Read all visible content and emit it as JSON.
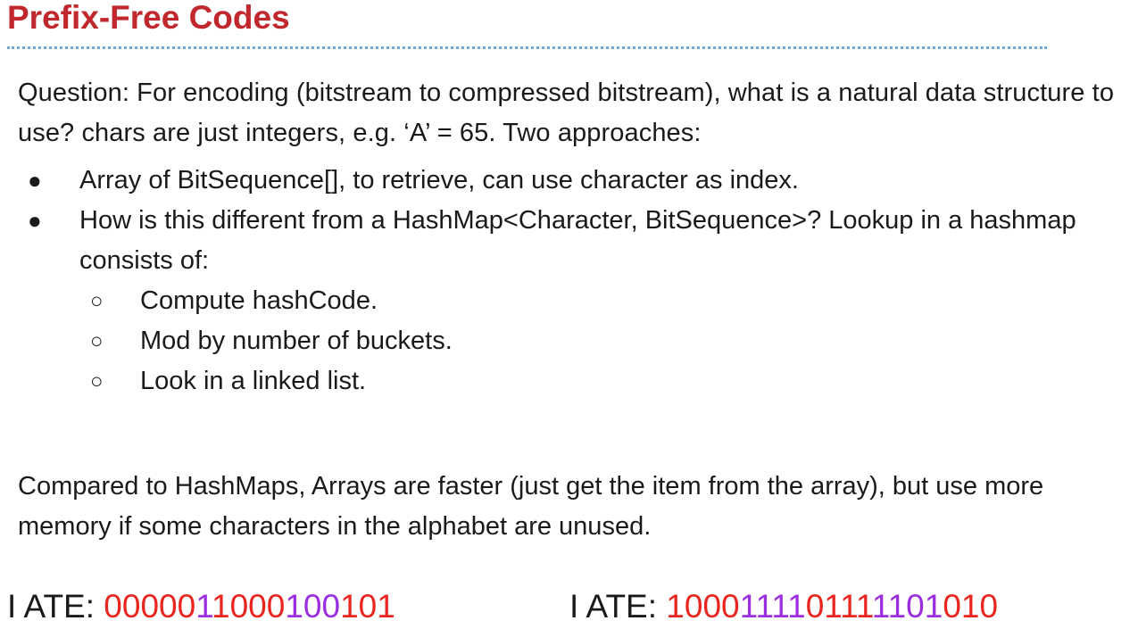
{
  "title": "Prefix-Free Codes",
  "question": "Question: For encoding (bitstream to compressed bitstream), what is a natural data structure to use?  chars are just integers, e.g. ‘A’ = 65. Two approaches:",
  "bullets": [
    {
      "marker": "●",
      "text": "Array of BitSequence[], to retrieve, can use character as index."
    },
    {
      "marker": "●",
      "text": "How is this different from a HashMap<Character, BitSequence>? Lookup in a hashmap consists of:",
      "sub_items": [
        {
          "marker": "○",
          "text": "Compute hashCode."
        },
        {
          "marker": "○",
          "text": "Mod by number of buckets."
        },
        {
          "marker": "○",
          "text": "Look in a linked list."
        }
      ]
    }
  ],
  "comparison": "Compared to HashMaps, Arrays are faster (just get the item from the array), but use more memory if some characters in the alphabet are unused.",
  "encodings": [
    {
      "label": "I ATE: ",
      "segments": [
        {
          "bits": "00000",
          "color": "#e8251f"
        },
        {
          "bits": "1",
          "color": "#9b2fe0"
        },
        {
          "bits": "1000",
          "color": "#e8251f"
        },
        {
          "bits": "100",
          "color": "#9b2fe0"
        },
        {
          "bits": "101",
          "color": "#e8251f"
        }
      ]
    },
    {
      "label": "I ATE: ",
      "segments": [
        {
          "bits": "1000",
          "color": "#e8251f"
        },
        {
          "bits": "1111",
          "color": "#9b2fe0"
        },
        {
          "bits": "0111",
          "color": "#e8251f"
        },
        {
          "bits": "1101",
          "color": "#9b2fe0"
        },
        {
          "bits": "010",
          "color": "#e8251f"
        }
      ]
    }
  ],
  "colors": {
    "title": "#c0282d",
    "rule": "#6fa8d6",
    "bit_red": "#e8251f",
    "bit_purple": "#9b2fe0"
  }
}
